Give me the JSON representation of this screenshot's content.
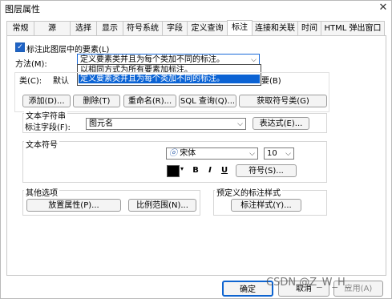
{
  "window": {
    "title": "图层属性",
    "close_glyph": "✕"
  },
  "tabs": [
    {
      "label": "常规"
    },
    {
      "label": "源"
    },
    {
      "label": "选择"
    },
    {
      "label": "显示"
    },
    {
      "label": "符号系统"
    },
    {
      "label": "字段"
    },
    {
      "label": "定义查询"
    },
    {
      "label": "标注"
    },
    {
      "label": "连接和关联"
    },
    {
      "label": "时间"
    },
    {
      "label": "HTML 弹出窗口"
    }
  ],
  "label_features": {
    "label": "标注此图层中的要素(L)",
    "checked": true
  },
  "method": {
    "label": "方法(M):",
    "value": "定义要素类并且为每个类加不同的标注。",
    "options": [
      "以相同方式为所有要素加标注。",
      "定义要素类并且为每个类加不同的标注。"
    ]
  },
  "class": {
    "label": "类(C):",
    "value": "默认",
    "right_fragment": "要(B)"
  },
  "class_buttons": {
    "add": "添加(D)...",
    "delete": "删除(T)",
    "rename": "重命名(R)...",
    "sql": "SQL 查询(Q)...",
    "get_classes": "获取符号类(G)"
  },
  "text_string": {
    "group_label": "文本字符串",
    "field_label": "标注字段(F):",
    "field_value": "图元名",
    "expression_button": "表达式(E)..."
  },
  "text_symbol": {
    "group_label": "文本符号",
    "font_value": "宋体",
    "size_value": "10",
    "bold": "B",
    "italic": "I",
    "underline": "U",
    "symbol_button": "符号(S)...",
    "color": "#000000"
  },
  "other_options": {
    "group_label": "其他选项",
    "placement_button": "放置属性(P)...",
    "scale_button": "比例范围(N)..."
  },
  "predefined": {
    "group_label": "预定义的标注样式",
    "style_button": "标注样式(Y)..."
  },
  "footer": {
    "ok": "确定",
    "cancel": "取消",
    "apply": "应用(A)"
  },
  "watermark": "CSDN @Z_W_H_"
}
